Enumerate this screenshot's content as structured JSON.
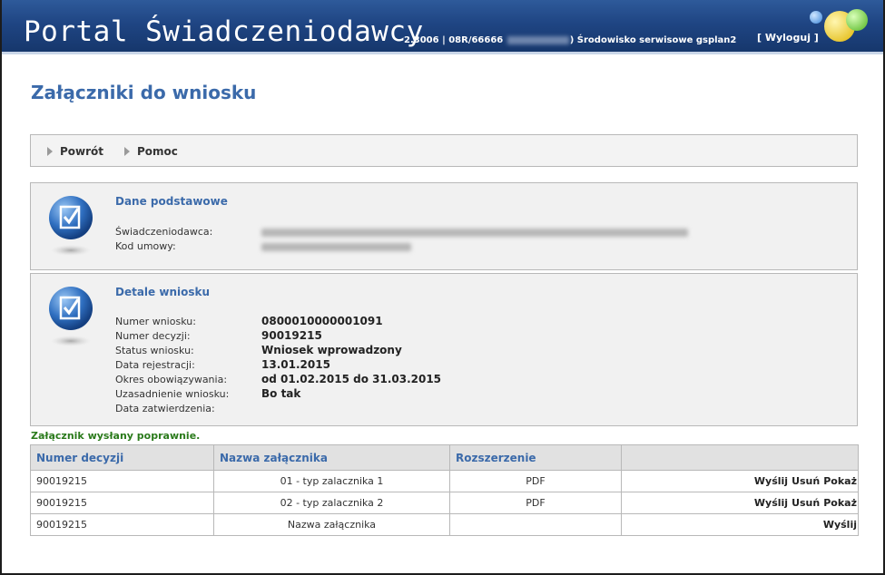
{
  "header": {
    "title": "Portal Świadczeniodawcy",
    "version": "2.3006 | 08R/66666",
    "environment": ") Środowisko serwisowe gsplan2",
    "logout_label": "[ Wyloguj ]"
  },
  "page": {
    "title": "Załączniki do wniosku"
  },
  "toolbar": {
    "back_label": "Powrót",
    "help_label": "Pomoc"
  },
  "basic_data": {
    "title": "Dane podstawowe",
    "provider_label": "Świadczeniodawca:",
    "contract_label": "Kod umowy:"
  },
  "request_details": {
    "title": "Detale wniosku",
    "fields": [
      {
        "label": "Numer wniosku:",
        "value": "0800010000001091"
      },
      {
        "label": "Numer decyzji:",
        "value": "90019215"
      },
      {
        "label": "Status wniosku:",
        "value": "Wniosek wprowadzony"
      },
      {
        "label": "Data rejestracji:",
        "value": "13.01.2015"
      },
      {
        "label": "Okres obowiązywania:",
        "value": "od 01.02.2015 do 31.03.2015"
      },
      {
        "label": "Uzasadnienie wniosku:",
        "value": "Bo tak"
      },
      {
        "label": "Data zatwierdzenia:",
        "value": ""
      }
    ]
  },
  "message": "Załącznik wysłany poprawnie.",
  "table": {
    "headers": [
      "Numer decyzji",
      "Nazwa załącznika",
      "Rozszerzenie",
      ""
    ],
    "rows": [
      {
        "decision": "90019215",
        "name": "01 - typ zalacznika 1",
        "ext": "PDF",
        "send": "Wyślij",
        "delete": "Usuń",
        "show": "Pokaż"
      },
      {
        "decision": "90019215",
        "name": "02 - typ zalacznika 2",
        "ext": "PDF",
        "send": "Wyślij",
        "delete": "Usuń",
        "show": "Pokaż"
      },
      {
        "decision": "90019215",
        "name": "Nazwa załącznika",
        "ext": "",
        "send": "Wyślij"
      }
    ]
  },
  "colors": {
    "header_blue": "#1f4583",
    "title_blue": "#3b6aaa",
    "success_green": "#2a7a1b"
  }
}
